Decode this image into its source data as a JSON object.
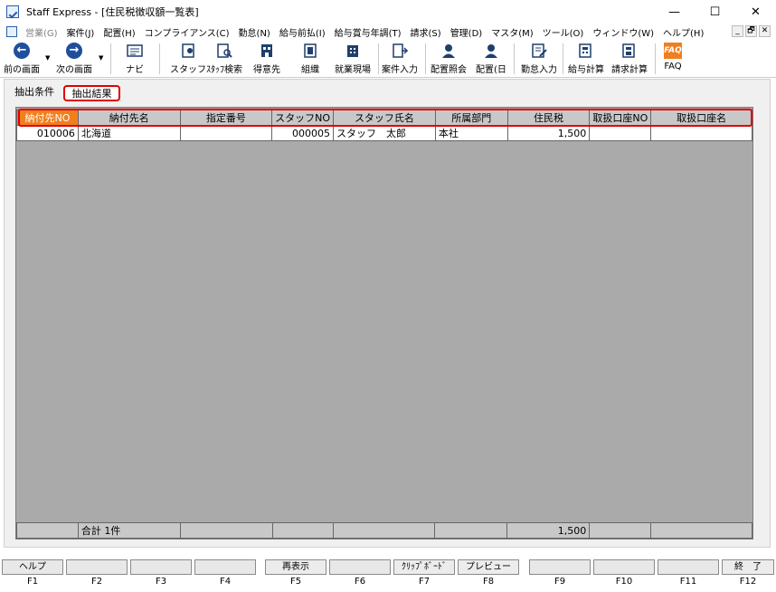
{
  "window": {
    "title": "Staff Express - [住民税徴収額一覧表]",
    "minimize": "—",
    "maximize": "☐",
    "close": "✕"
  },
  "menu": {
    "items": [
      {
        "label": "営業(G)",
        "disabled": true
      },
      {
        "label": "案件(J)"
      },
      {
        "label": "配置(H)"
      },
      {
        "label": "コンプライアンス(C)"
      },
      {
        "label": "勤怠(N)"
      },
      {
        "label": "給与前払(I)"
      },
      {
        "label": "給与賞与年調(T)"
      },
      {
        "label": "請求(S)"
      },
      {
        "label": "管理(D)"
      },
      {
        "label": "マスタ(M)"
      },
      {
        "label": "ツール(O)"
      },
      {
        "label": "ウィンドウ(W)"
      },
      {
        "label": "ヘルプ(H)"
      }
    ],
    "mdi": [
      "_",
      "🗗",
      "✕"
    ]
  },
  "toolbar": {
    "back": "前の画面",
    "next": "次の画面",
    "navi": "ナビ",
    "staff": "スタッフ",
    "staff_search": "ｽﾀｯﾌ検索",
    "client": "得意先",
    "org": "組織",
    "worksite": "就業現場",
    "job_input": "案件入力",
    "assign_view": "配置照会",
    "assign_day": "配置(日",
    "attendance": "勤怠入力",
    "payroll": "給与計算",
    "billing": "請求計算",
    "faq": "FAQ",
    "faq_badge": "FAQ"
  },
  "tabs": {
    "criteria": "抽出条件",
    "results": "抽出結果"
  },
  "table": {
    "headers": [
      "納付先NO",
      "納付先名",
      "指定番号",
      "スタッフNO",
      "スタッフ氏名",
      "所属部門",
      "住民税",
      "取扱口座NO",
      "取扱口座名"
    ],
    "rows": [
      [
        "010006",
        "北海道",
        "",
        "000005",
        "スタッフ　太郎",
        "本社",
        "1,500",
        "",
        ""
      ]
    ],
    "footer": [
      "",
      "合計 1件",
      "",
      "",
      "",
      "",
      "1,500",
      "",
      ""
    ]
  },
  "fkeys": [
    {
      "btn": "ヘルプ",
      "key": "F1"
    },
    {
      "btn": "",
      "key": "F2"
    },
    {
      "btn": "",
      "key": "F3"
    },
    {
      "btn": "",
      "key": "F4"
    },
    {
      "btn": "再表示",
      "key": "F5"
    },
    {
      "btn": "",
      "key": "F6"
    },
    {
      "btn": "ｸﾘｯﾌﾟﾎﾞｰﾄﾞ",
      "key": "F7"
    },
    {
      "btn": "プレビュー",
      "key": "F8"
    },
    {
      "btn": "",
      "key": "F9"
    },
    {
      "btn": "",
      "key": "F10"
    },
    {
      "btn": "",
      "key": "F11"
    },
    {
      "btn": "終　了",
      "key": "F12"
    }
  ],
  "colors": {
    "accent_orange": "#f07f1f",
    "highlight_red": "#e00000",
    "grid_bg": "#aaaaaa"
  }
}
